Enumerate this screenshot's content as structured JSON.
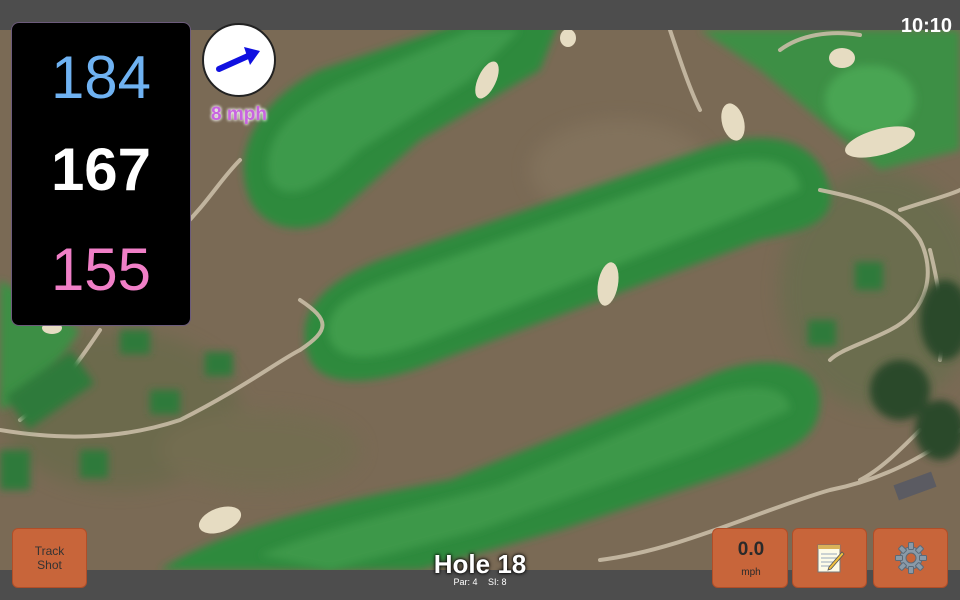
{
  "status": {
    "time": "10:10"
  },
  "distances": {
    "back": "184",
    "middle": "167",
    "front": "155"
  },
  "wind": {
    "speed_label": "8 mph",
    "arrow_color": "#1010e0"
  },
  "buttons": {
    "track_shot_line1": "Track",
    "track_shot_line2": "Shot",
    "speed_value": "0.0",
    "speed_unit": "mph",
    "notes_icon": "notepad-icon",
    "settings_icon": "gear-icon"
  },
  "hole": {
    "title": "Hole 18",
    "par": "Par: 4",
    "si": "SI: 8"
  },
  "colors": {
    "back": "#6fb2f2",
    "middle": "#ffffff",
    "front": "#f07fc7",
    "button": "#c8653a",
    "wind_text": "#c864e0"
  }
}
